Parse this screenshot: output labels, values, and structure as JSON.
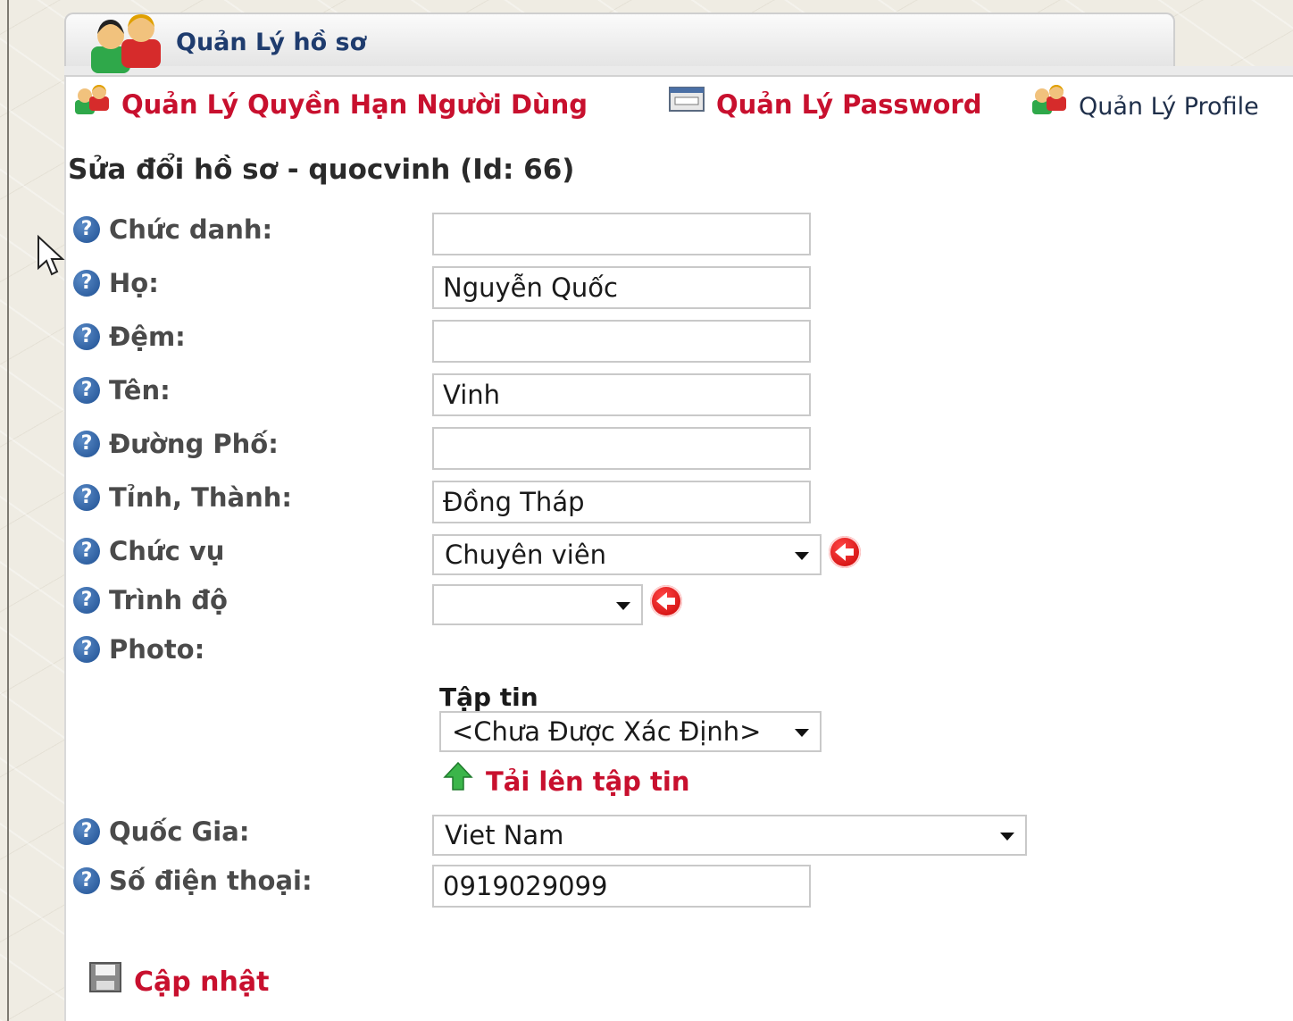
{
  "tab": {
    "title": "Quản Lý hồ sơ"
  },
  "menu": [
    {
      "label": "Quản Lý Quyền Hạn Người Dùng",
      "icon": "user-group-icon"
    },
    {
      "label": "Quản Lý Password",
      "icon": "password-icon"
    },
    {
      "label": "Quản Lý Profile",
      "icon": "user-group-icon"
    }
  ],
  "heading": "Sửa đổi hồ sơ - quocvinh (Id: 66)",
  "form": {
    "title_label": "Chức danh:",
    "title_value": "",
    "last_name_label": "Họ:",
    "last_name_value": "Nguyễn Quốc",
    "middle_label": "Đệm:",
    "middle_value": "",
    "first_name_label": "Tên:",
    "first_name_value": "Vinh",
    "street_label": "Đường Phố:",
    "street_value": "",
    "province_label": "Tỉnh, Thành:",
    "province_value": "Đồng Tháp",
    "position_label": "Chức vụ",
    "position_value": "Chuyên viên",
    "level_label": "Trình độ",
    "level_value": "",
    "photo_label": "Photo:",
    "file_label": "Tập tin",
    "file_value": "<Chưa Được Xác Định>",
    "upload_label": "Tải lên tập tin",
    "country_label": "Quốc Gia:",
    "country_value": "Viet Nam",
    "phone_label": "Số điện thoại:",
    "phone_value": "0919029099"
  },
  "save_label": "Cập nhật",
  "colors": {
    "link_red": "#c8102e",
    "label_gray": "#4a4a4a",
    "help_blue": "#1e4f92"
  }
}
